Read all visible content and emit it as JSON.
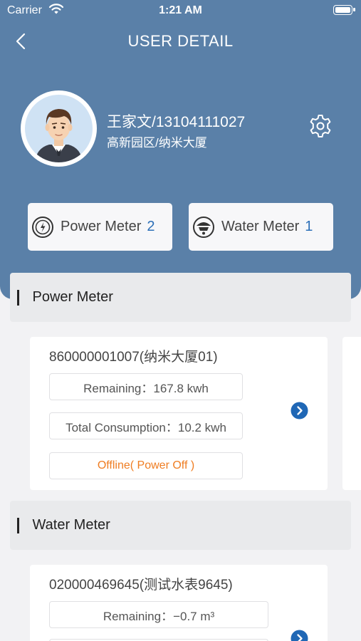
{
  "status_bar": {
    "carrier": "Carrier",
    "time": "1:21 AM"
  },
  "nav": {
    "title": "USER DETAIL"
  },
  "user": {
    "name_phone": "王家文/13104111027",
    "address": "高新园区/纳米大厦"
  },
  "summary": {
    "power": {
      "label": "Power Meter",
      "count": "2"
    },
    "water": {
      "label": "Water Meter",
      "count": "1"
    }
  },
  "power_section": {
    "title": "Power Meter",
    "card": {
      "id_name": "860000001007(纳米大厦01)",
      "remaining": "Remaining：167.8 kwh",
      "consumption": "Total Consumption：10.2 kwh",
      "status": "Offline( Power Off )"
    }
  },
  "water_section": {
    "title": "Water Meter",
    "card": {
      "id_name": "020000469645(测试水表9645)",
      "remaining": "Remaining：−0.7 m³"
    }
  },
  "colors": {
    "header_bg": "#5a80a8",
    "accent_blue": "#2c6fb8",
    "status_orange": "#ef7d22"
  },
  "icons": [
    "wifi-icon",
    "battery-icon",
    "back-chevron-icon",
    "settings-gear-icon",
    "power-meter-icon",
    "water-meter-icon",
    "chevron-right-circle-icon"
  ]
}
